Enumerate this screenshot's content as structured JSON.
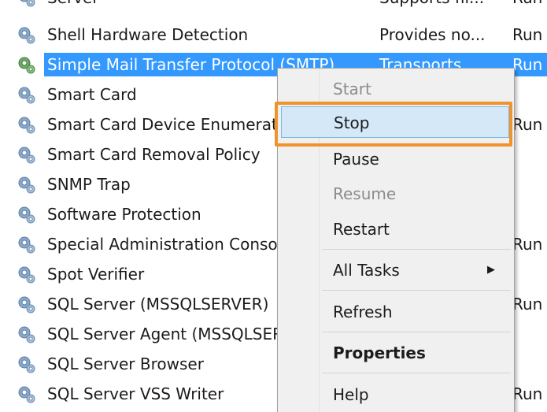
{
  "services": [
    {
      "name": "Server",
      "description": "Supports fil...",
      "status": "Run",
      "partial": true
    },
    {
      "name": "Shell Hardware Detection",
      "description": "Provides no...",
      "status": "Run"
    },
    {
      "name": "Simple Mail Transfer Protocol (SMTP)",
      "description": "Transports ...",
      "status": "Run",
      "selected": true
    },
    {
      "name": "Smart Card",
      "description": "",
      "status": ""
    },
    {
      "name": "Smart Card Device Enumeration Service",
      "description": "",
      "status": "Run"
    },
    {
      "name": "Smart Card Removal Policy",
      "description": "",
      "status": ""
    },
    {
      "name": "SNMP Trap",
      "description": "",
      "status": ""
    },
    {
      "name": "Software Protection",
      "description": "",
      "status": ""
    },
    {
      "name": "Special Administration Console Helper",
      "description": "",
      "status": "Run"
    },
    {
      "name": "Spot Verifier",
      "description": "",
      "status": ""
    },
    {
      "name": "SQL Server (MSSQLSERVER)",
      "description": "",
      "status": "Run"
    },
    {
      "name": "SQL Server Agent (MSSQLSERVER)",
      "description": "",
      "status": ""
    },
    {
      "name": "SQL Server Browser",
      "description": "",
      "status": ""
    },
    {
      "name": "SQL Server VSS Writer",
      "description": "",
      "status": "Run"
    }
  ],
  "context_menu": {
    "start": "Start",
    "stop": "Stop",
    "pause": "Pause",
    "resume": "Resume",
    "restart": "Restart",
    "all_tasks": "All Tasks",
    "all_tasks_arrow": "▶",
    "refresh": "Refresh",
    "properties": "Properties",
    "help": "Help"
  },
  "icons": {
    "service": "gear-icon",
    "submenu": "chevron-right-icon"
  },
  "colors": {
    "selection": "#3399ff",
    "menu_hover": "#d5e8f8",
    "callout": "#f0932b"
  }
}
